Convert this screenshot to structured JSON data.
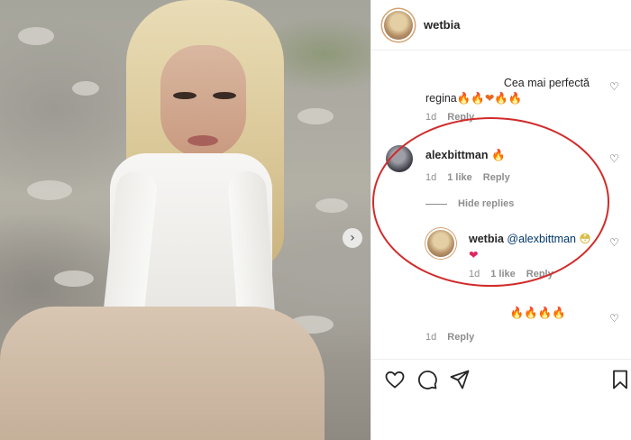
{
  "post": {
    "username": "wetbia"
  },
  "comments": [
    {
      "text": "Cea mai perfectă regina",
      "line1": "Cea mai perfectă",
      "line2": "regina",
      "emojis": "🔥🔥❤🔥🔥",
      "time": "1d",
      "reply": "Reply"
    },
    {
      "username": "alexbittman",
      "emoji": "🔥",
      "time": "1d",
      "likes": "1 like",
      "reply": "Reply",
      "hide_replies": "Hide replies",
      "replies": [
        {
          "username": "wetbia",
          "mention": "@alexbittman",
          "emoji": "😳",
          "heart": "❤",
          "time": "1d",
          "likes": "1 like",
          "reply": "Reply"
        }
      ]
    },
    {
      "emojis": "🔥🔥🔥🔥",
      "time": "1d",
      "reply": "Reply"
    }
  ],
  "actions": {
    "like": "heart-icon",
    "comment": "comment-icon",
    "share": "share-icon",
    "save": "bookmark-icon"
  },
  "colors": {
    "annotation": "#d12b2b",
    "fire": "#e8681f",
    "heart": "#e0245e",
    "meta": "#8e8e8e"
  }
}
